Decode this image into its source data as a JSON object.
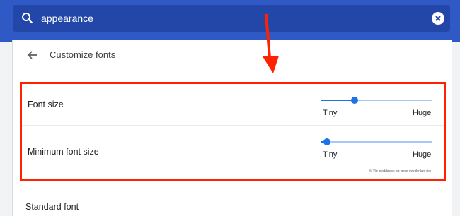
{
  "search": {
    "value": "appearance"
  },
  "header": {
    "title": "Customize fonts"
  },
  "settings": {
    "font_size": {
      "label": "Font size",
      "level": 0.3,
      "min_label": "Tiny",
      "max_label": "Huge"
    },
    "minimum_font_size": {
      "label": "Minimum font size",
      "level": 0.05,
      "min_label": "Tiny",
      "max_label": "Huge",
      "sample": "6: The quick brown fox jumps over the lazy dog"
    },
    "next_item": "Standard font"
  },
  "icons": {
    "search": "search-icon",
    "clear": "close-circle-icon",
    "back": "back-arrow-icon"
  },
  "colors": {
    "header_band": "#2f59c4",
    "search_bar": "#2346a9",
    "slider_accent": "#1a73e8",
    "highlight": "#ff2200"
  }
}
